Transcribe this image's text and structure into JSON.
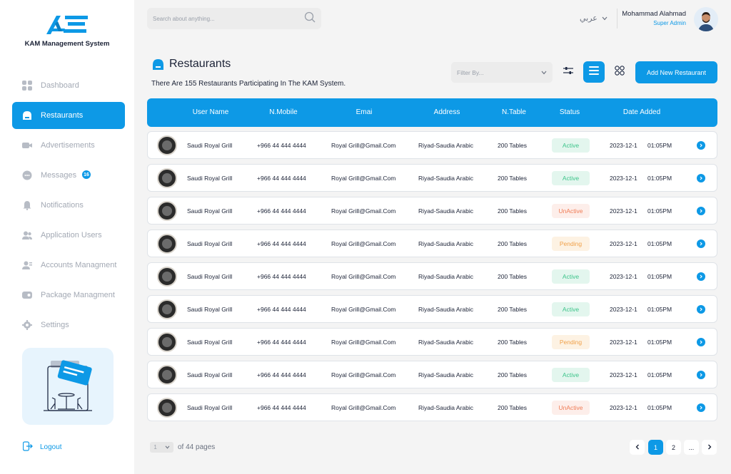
{
  "app": {
    "name": "KAM Management System"
  },
  "sidebar": {
    "items": [
      {
        "label": "Dashboard",
        "icon": "dashboard-icon",
        "active": false
      },
      {
        "label": "Restaurants",
        "icon": "restaurant-icon",
        "active": true
      },
      {
        "label": "Advertisements",
        "icon": "video-icon",
        "active": false
      },
      {
        "label": "Messages",
        "icon": "message-icon",
        "active": false,
        "badge": "16"
      },
      {
        "label": "Notifications",
        "icon": "bell-icon",
        "active": false
      },
      {
        "label": "Application Users",
        "icon": "users-icon",
        "active": false
      },
      {
        "label": "Accounts Managment",
        "icon": "accounts-icon",
        "active": false
      },
      {
        "label": "Package Managment",
        "icon": "package-icon",
        "active": false
      },
      {
        "label": "Settings",
        "icon": "gear-icon",
        "active": false
      }
    ],
    "logout_label": "Logout"
  },
  "header": {
    "search_placeholder": "Search about anything...",
    "language": "عربي",
    "user_name": "Mohammad Alahmad",
    "user_role": "Super Admin"
  },
  "page": {
    "title": "Restaurants",
    "subtitle": "There Are 155 Restaurants Participating In The KAM System.",
    "filter_placeholder": "Filter By...",
    "add_button": "Add New Restaurant"
  },
  "table": {
    "columns": [
      "User Name",
      "N.Mobile",
      "Emai",
      "Address",
      "N.Table",
      "Status",
      "Date Added"
    ],
    "rows": [
      {
        "name": "Saudi Royal Grill",
        "mobile": "+966 44 444 4444",
        "email": "Royal Grill@Gmail.Com",
        "address": "Riyad-Saudia Arabic",
        "tables": "200  Tables",
        "status": "Active",
        "date": "2023-12-1",
        "time": "01:05PM"
      },
      {
        "name": "Saudi Royal Grill",
        "mobile": "+966 44 444 4444",
        "email": "Royal Grill@Gmail.Com",
        "address": "Riyad-Saudia Arabic",
        "tables": "200  Tables",
        "status": "Active",
        "date": "2023-12-1",
        "time": "01:05PM"
      },
      {
        "name": "Saudi Royal Grill",
        "mobile": "+966 44 444 4444",
        "email": "Royal Grill@Gmail.Com",
        "address": "Riyad-Saudia Arabic",
        "tables": "200  Tables",
        "status": "UnActive",
        "date": "2023-12-1",
        "time": "01:05PM"
      },
      {
        "name": "Saudi Royal Grill",
        "mobile": "+966 44 444 4444",
        "email": "Royal Grill@Gmail.Com",
        "address": "Riyad-Saudia Arabic",
        "tables": "200  Tables",
        "status": "Pending",
        "date": "2023-12-1",
        "time": "01:05PM"
      },
      {
        "name": "Saudi Royal Grill",
        "mobile": "+966 44 444 4444",
        "email": "Royal Grill@Gmail.Com",
        "address": "Riyad-Saudia Arabic",
        "tables": "200  Tables",
        "status": "Active",
        "date": "2023-12-1",
        "time": "01:05PM"
      },
      {
        "name": "Saudi Royal Grill",
        "mobile": "+966 44 444 4444",
        "email": "Royal Grill@Gmail.Com",
        "address": "Riyad-Saudia Arabic",
        "tables": "200  Tables",
        "status": "Active",
        "date": "2023-12-1",
        "time": "01:05PM"
      },
      {
        "name": "Saudi Royal Grill",
        "mobile": "+966 44 444 4444",
        "email": "Royal Grill@Gmail.Com",
        "address": "Riyad-Saudia Arabic",
        "tables": "200  Tables",
        "status": "Pending",
        "date": "2023-12-1",
        "time": "01:05PM"
      },
      {
        "name": "Saudi Royal Grill",
        "mobile": "+966 44 444 4444",
        "email": "Royal Grill@Gmail.Com",
        "address": "Riyad-Saudia Arabic",
        "tables": "200  Tables",
        "status": "Active",
        "date": "2023-12-1",
        "time": "01:05PM"
      },
      {
        "name": "Saudi Royal Grill",
        "mobile": "+966 44 444 4444",
        "email": "Royal Grill@Gmail.Com",
        "address": "Riyad-Saudia Arabic",
        "tables": "200  Tables",
        "status": "UnActive",
        "date": "2023-12-1",
        "time": "01:05PM"
      }
    ]
  },
  "pagination": {
    "current_page": "1",
    "of_pages": "of 44 pages",
    "pages": [
      "1",
      "2",
      "..."
    ]
  },
  "colors": {
    "accent": "#0d99e6",
    "active": "#3cc48a",
    "unactive": "#f07c56",
    "pending": "#f0a14a"
  }
}
